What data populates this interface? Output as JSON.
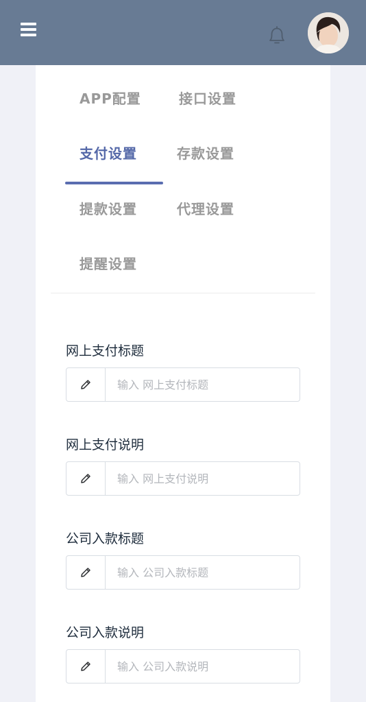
{
  "header": {
    "menu_icon": "hamburger-menu-icon",
    "bell_icon": "bell-icon",
    "avatar": "user-avatar"
  },
  "tabs": [
    {
      "label": "APP配置",
      "active": false
    },
    {
      "label": "接口设置",
      "active": false
    },
    {
      "label": "支付设置",
      "active": true
    },
    {
      "label": "存款设置",
      "active": false
    },
    {
      "label": "提款设置",
      "active": false
    },
    {
      "label": "代理设置",
      "active": false
    },
    {
      "label": "提醒设置",
      "active": false
    }
  ],
  "form": {
    "fields": [
      {
        "label": "网上支付标题",
        "placeholder": "输入 网上支付标题",
        "icon": "pencil-icon"
      },
      {
        "label": "网上支付说明",
        "placeholder": "输入 网上支付说明",
        "icon": "pencil-icon"
      },
      {
        "label": "公司入款标题",
        "placeholder": "输入 公司入款标题",
        "icon": "pencil-icon"
      },
      {
        "label": "公司入款说明",
        "placeholder": "输入 公司入款说明",
        "icon": "pencil-icon"
      }
    ]
  },
  "colors": {
    "header_bg": "#687b94",
    "active_tab": "#5468a8",
    "inactive_tab": "#999999",
    "page_bg": "#f0f1f7"
  }
}
